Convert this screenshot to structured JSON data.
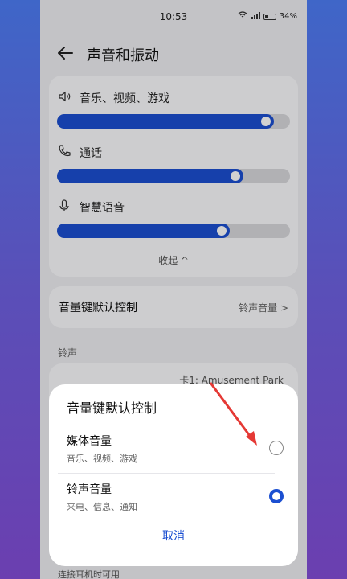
{
  "status": {
    "time": "10:53",
    "battery": "34%"
  },
  "header": {
    "title": "声音和振动"
  },
  "volume": {
    "items": [
      {
        "label": "音乐、视频、游戏",
        "icon": "speaker-icon",
        "level": 0.93
      },
      {
        "label": "通话",
        "icon": "phone-icon",
        "level": 0.8
      },
      {
        "label": "智慧语音",
        "icon": "microphone-icon",
        "level": 0.74
      }
    ],
    "collapse_label": "收起 ^"
  },
  "key_control": {
    "label": "音量键默认控制",
    "value": "铃声音量 >"
  },
  "ringtone": {
    "section_label": "铃声",
    "sim_label": "卡1: Amusement Park"
  },
  "bottom_hint": "连接耳机时可用",
  "dialog": {
    "title": "音量键默认控制",
    "options": [
      {
        "title": "媒体音量",
        "subtitle": "音乐、视频、游戏",
        "checked": false
      },
      {
        "title": "铃声音量",
        "subtitle": "来电、信息、通知",
        "checked": true
      }
    ],
    "cancel_label": "取消"
  },
  "colors": {
    "accent": "#1b4fd1",
    "annotation_arrow": "#e53935"
  }
}
